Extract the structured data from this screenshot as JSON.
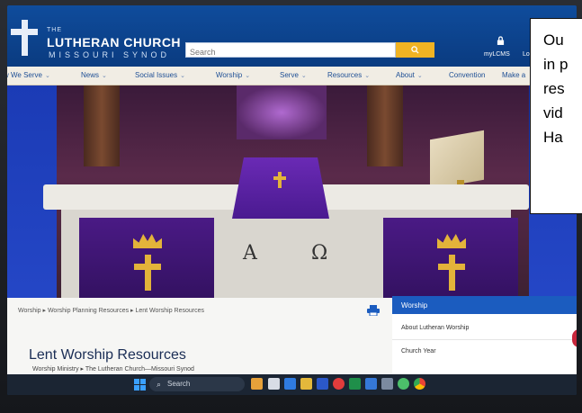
{
  "site": {
    "logo_small": "THE",
    "logo_name": "LUTHERAN CHURCH",
    "logo_sub": "MISSOURI SYNOD"
  },
  "header": {
    "search_placeholder": "Search",
    "mylcms": "myLCMS",
    "login": "Lo"
  },
  "nav": {
    "items": [
      {
        "label": "w We Serve"
      },
      {
        "label": "News"
      },
      {
        "label": "Social Issues"
      },
      {
        "label": "Worship"
      },
      {
        "label": "Serve"
      },
      {
        "label": "Resources"
      },
      {
        "label": "About"
      },
      {
        "label": "Convention"
      },
      {
        "label": "Make a"
      }
    ]
  },
  "hero": {
    "alpha": "A",
    "omega": "Ω"
  },
  "content": {
    "breadcrumb": "Worship  ▸  Worship Planning Resources  ▸  Lent Worship Resources",
    "title": "Lent Worship Resources",
    "subtitle": "Worship Ministry  ▸  The Lutheran Church—Missouri Synod"
  },
  "side_nav": {
    "heading": "Worship",
    "items": [
      "About Lutheran Worship",
      "Church Year"
    ]
  },
  "taskbar": {
    "search": "Search"
  },
  "callout": {
    "text": "Ou\nin p\nres\nvid\nHa"
  },
  "colors": {
    "header_blue": "#0f4c9c",
    "accent_gold": "#f0b323",
    "lent_purple": "#4a1a85",
    "side_nav_blue": "#1b5cbf"
  }
}
